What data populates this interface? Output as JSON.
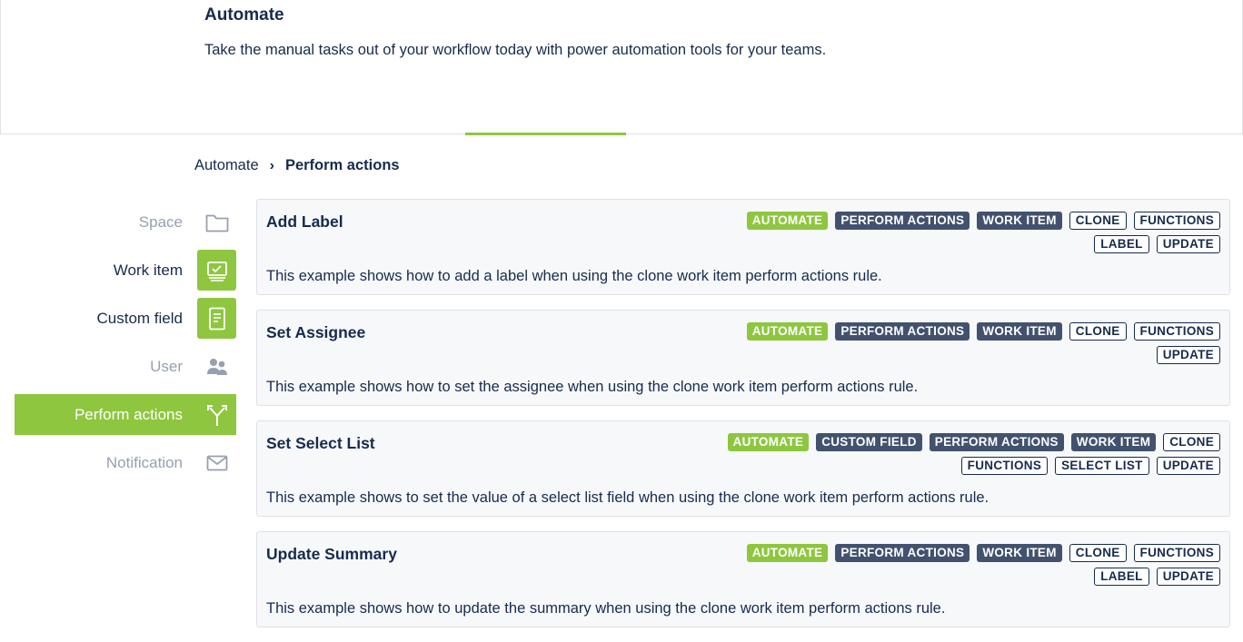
{
  "header": {
    "title": "Automate",
    "description": "Take the manual tasks out of your workflow today with power automation tools for your teams."
  },
  "breadcrumb": {
    "root": "Automate",
    "current": "Perform actions"
  },
  "sidebar": {
    "items": [
      {
        "label": "Space",
        "icon": "folder-icon"
      },
      {
        "label": "Work item",
        "icon": "work-item-icon"
      },
      {
        "label": "Custom field",
        "icon": "custom-field-icon"
      },
      {
        "label": "User",
        "icon": "users-icon"
      },
      {
        "label": "Perform actions",
        "icon": "branch-icon"
      },
      {
        "label": "Notification",
        "icon": "envelope-icon"
      }
    ]
  },
  "cards": [
    {
      "title": "Add Label",
      "description": "This example shows how to add a label when using the clone work item perform actions rule.",
      "tags": [
        "AUTOMATE",
        "PERFORM ACTIONS",
        "WORK ITEM",
        "CLONE",
        "FUNCTIONS",
        "LABEL",
        "UPDATE"
      ]
    },
    {
      "title": "Set Assignee",
      "description": "This example shows how to set the assignee when using the clone work item perform actions rule.",
      "tags": [
        "AUTOMATE",
        "PERFORM ACTIONS",
        "WORK ITEM",
        "CLONE",
        "FUNCTIONS",
        "UPDATE"
      ]
    },
    {
      "title": "Set Select List",
      "description": "This example shows to set the value of a select list field when using the clone work item perform actions rule.",
      "tags": [
        "AUTOMATE",
        "CUSTOM FIELD",
        "PERFORM ACTIONS",
        "WORK ITEM",
        "CLONE",
        "FUNCTIONS",
        "SELECT LIST",
        "UPDATE"
      ]
    },
    {
      "title": "Update Summary",
      "description": "This example shows how to update the summary when using the clone work item perform actions rule.",
      "tags": [
        "AUTOMATE",
        "PERFORM ACTIONS",
        "WORK ITEM",
        "CLONE",
        "FUNCTIONS",
        "LABEL",
        "UPDATE"
      ]
    }
  ],
  "colors": {
    "accent": "#8ec63f",
    "dark_tag": "#42526e",
    "text": "#172b4d",
    "muted": "#97a0af"
  }
}
